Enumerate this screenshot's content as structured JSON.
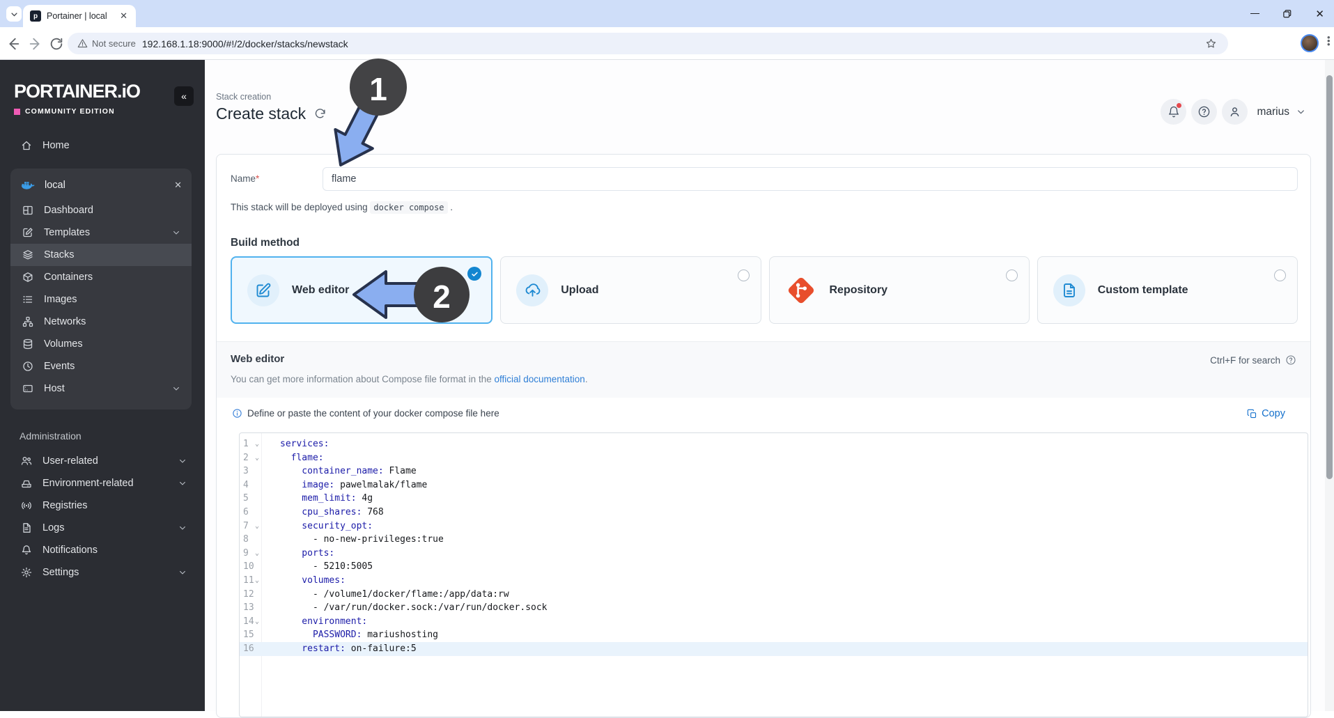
{
  "browser": {
    "tab_title": "Portainer | local",
    "favicon_letter": "p",
    "security_label": "Not secure",
    "url": "192.168.1.18:9000/#!/2/docker/stacks/newstack"
  },
  "sidebar": {
    "logo": "PORTAINER.iO",
    "edition": "COMMUNITY EDITION",
    "collapse_glyph": "«",
    "home_label": "Home",
    "environment": {
      "name": "local",
      "items": [
        {
          "label": "Dashboard"
        },
        {
          "label": "Templates",
          "chevron": true
        },
        {
          "label": "Stacks",
          "selected": true
        },
        {
          "label": "Containers"
        },
        {
          "label": "Images"
        },
        {
          "label": "Networks"
        },
        {
          "label": "Volumes"
        },
        {
          "label": "Events"
        },
        {
          "label": "Host",
          "chevron": true
        }
      ]
    },
    "admin": {
      "heading": "Administration",
      "items": [
        {
          "label": "User-related",
          "chevron": true
        },
        {
          "label": "Environment-related",
          "chevron": true
        },
        {
          "label": "Registries"
        },
        {
          "label": "Logs",
          "chevron": true
        },
        {
          "label": "Notifications"
        },
        {
          "label": "Settings",
          "chevron": true
        }
      ]
    }
  },
  "header": {
    "breadcrumb": "Stack creation",
    "title": "Create stack",
    "username": "marius"
  },
  "form": {
    "name_label": "Name",
    "required_mark": "*",
    "name_value": "flame",
    "deploy_prefix": "This stack will be deployed using",
    "deploy_code": "docker compose",
    "deploy_suffix": "."
  },
  "build_method": {
    "heading": "Build method",
    "options": [
      {
        "label": "Web editor",
        "selected": true
      },
      {
        "label": "Upload",
        "selected": false
      },
      {
        "label": "Repository",
        "selected": false
      },
      {
        "label": "Custom template",
        "selected": false
      }
    ]
  },
  "web_editor": {
    "title": "Web editor",
    "search_hint": "Ctrl+F for search",
    "info_prefix": "You can get more information about Compose file format in the",
    "info_link": "official documentation",
    "info_suffix": ".",
    "instruction": "Define or paste the content of your docker compose file here",
    "copy_label": "Copy"
  },
  "editor": {
    "lines": [
      {
        "num": "1",
        "fold": true,
        "indent": 0,
        "key": "services:",
        "val": ""
      },
      {
        "num": "2",
        "fold": true,
        "indent": 2,
        "key": "flame:",
        "val": ""
      },
      {
        "num": "3",
        "fold": false,
        "indent": 4,
        "key": "container_name:",
        "val": " Flame"
      },
      {
        "num": "4",
        "fold": false,
        "indent": 4,
        "key": "image:",
        "val": " pawelmalak/flame"
      },
      {
        "num": "5",
        "fold": false,
        "indent": 4,
        "key": "mem_limit:",
        "val": " 4g"
      },
      {
        "num": "6",
        "fold": false,
        "indent": 4,
        "key": "cpu_shares:",
        "val": " 768"
      },
      {
        "num": "7",
        "fold": true,
        "indent": 4,
        "key": "security_opt:",
        "val": ""
      },
      {
        "num": "8",
        "fold": false,
        "indent": 6,
        "key": "",
        "val": "- no-new-privileges:true"
      },
      {
        "num": "9",
        "fold": true,
        "indent": 4,
        "key": "ports:",
        "val": ""
      },
      {
        "num": "10",
        "fold": false,
        "indent": 6,
        "key": "",
        "val": "- 5210:5005"
      },
      {
        "num": "11",
        "fold": true,
        "indent": 4,
        "key": "volumes:",
        "val": ""
      },
      {
        "num": "12",
        "fold": false,
        "indent": 6,
        "key": "",
        "val": "- /volume1/docker/flame:/app/data:rw"
      },
      {
        "num": "13",
        "fold": false,
        "indent": 6,
        "key": "",
        "val": "- /var/run/docker.sock:/var/run/docker.sock"
      },
      {
        "num": "14",
        "fold": true,
        "indent": 4,
        "key": "environment:",
        "val": ""
      },
      {
        "num": "15",
        "fold": false,
        "indent": 6,
        "key": "PASSWORD:",
        "val": " mariushosting"
      },
      {
        "num": "16",
        "fold": false,
        "indent": 4,
        "key": "restart:",
        "val": " on-failure:5",
        "active": true
      }
    ]
  },
  "annotations": {
    "step1": "1",
    "step2": "2"
  },
  "colors": {
    "accent_blue": "#1386d0",
    "selected_card_border": "#51b2ee",
    "repository_orange": "#e84e2c",
    "edition_pink": "#ef5bb5",
    "notification_red": "#e5484d",
    "arrow_fill": "#8aaef0",
    "arrow_outline": "#27324d",
    "code_key": "#1b1ba8"
  }
}
